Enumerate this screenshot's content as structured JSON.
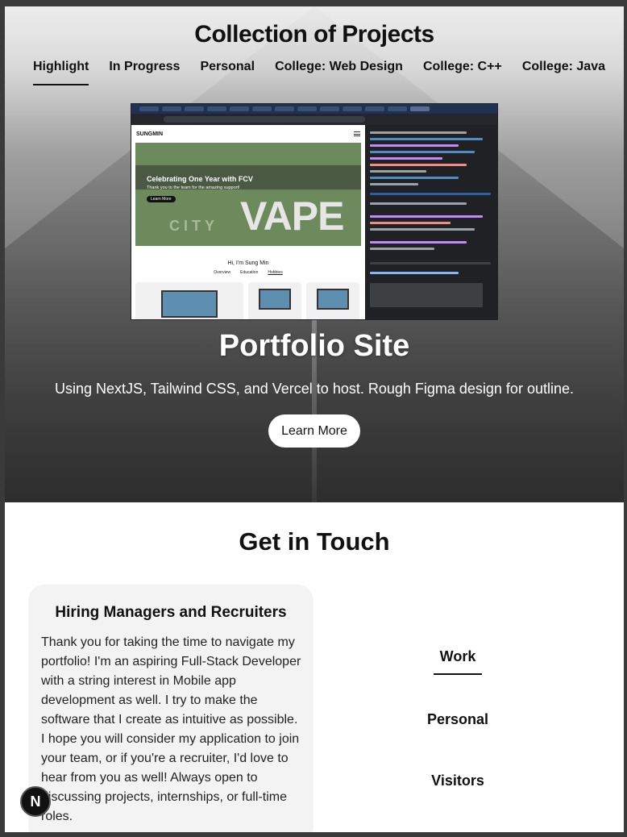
{
  "header": {
    "title": "Collection of Projects"
  },
  "tabs": [
    {
      "label": "Highlight",
      "active": true
    },
    {
      "label": "In Progress"
    },
    {
      "label": "Personal"
    },
    {
      "label": "College: Web Design"
    },
    {
      "label": "College: C++"
    },
    {
      "label": "College: Java"
    }
  ],
  "preview": {
    "logo": "SUNGMIN",
    "banner_title": "Celebrating One Year with FCV",
    "banner_sub": "Thank you to the team for the amazing support!",
    "banner_button": "Learn More",
    "banner_big": "VAPE",
    "banner_city": "CITY",
    "hello": "Hi, I'm Sung Min",
    "subtabs": [
      "Overview",
      "Education",
      "Hobbies"
    ]
  },
  "project": {
    "title": "Portfolio Site",
    "description": "Using NextJS, Tailwind CSS, and Vercel to host. Rough Figma design for outline.",
    "button": "Learn More"
  },
  "contact": {
    "title": "Get in Touch",
    "card_title": "Hiring Managers and Recruiters",
    "card_body": "Thank you for taking the time to navigate my portfolio! I'm an aspiring Full-Stack Developer with a string interest in Mobile app development as well. I try to make the software that I create as intuitive as possible. I hope you will consider my application to join your team, or if you're a recruiter, I'd love to hear from you as well! Always open to discussing projects, internships, or full-time roles.",
    "side_tabs": [
      {
        "label": "Work",
        "active": true
      },
      {
        "label": "Personal"
      },
      {
        "label": "Visitors"
      }
    ]
  },
  "badge": {
    "label": "N"
  },
  "colors": {
    "text": "#111111",
    "card_bg": "#f3f3f3",
    "hero_button_bg": "#ffffff"
  }
}
